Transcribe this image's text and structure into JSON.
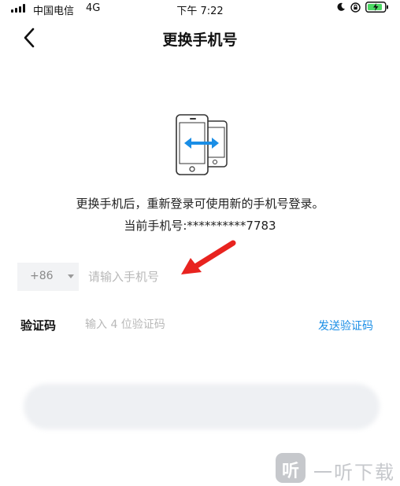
{
  "status_bar": {
    "carrier": "中国电信",
    "network": "4G",
    "time": "下午 7:22"
  },
  "nav": {
    "title": "更换手机号"
  },
  "info": {
    "description": "更换手机后，重新登录可使用新的手机号登录。",
    "current_phone": "当前手机号:**********7783"
  },
  "phone_form": {
    "country_code": "+86",
    "phone_placeholder": "请输入手机号",
    "code_label": "验证码",
    "code_placeholder": "输入 4 位验证码",
    "send_code_label": "发送验证码"
  },
  "watermark": {
    "icon_char": "听",
    "text": "一听下载"
  },
  "colors": {
    "accent": "#1a8ee6",
    "arrow": "#e8231f"
  },
  "icons": [
    "signal-icon",
    "moon-icon",
    "rotation-lock-icon",
    "battery-icon",
    "back-arrow-icon",
    "phone-swap-icon"
  ]
}
